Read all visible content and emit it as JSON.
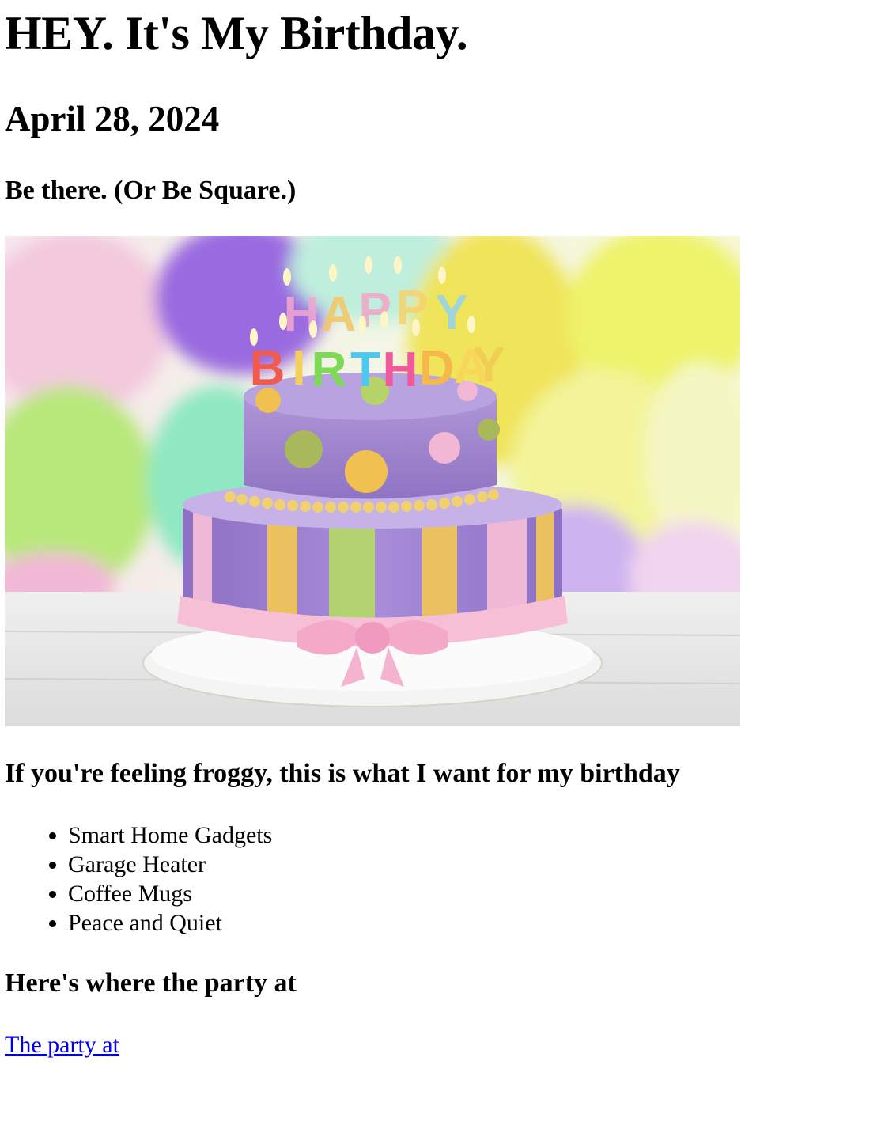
{
  "heading": "HEY. It's My Birthday.",
  "date": "April 28, 2024",
  "tagline": "Be there. (Or Be Square.)",
  "image": {
    "candle_letters_top": "HAPPY",
    "candle_letters_bottom": "BIRTHDAY"
  },
  "wishlist": {
    "title": "If you're feeling froggy, this is what I want for my birthday",
    "items": [
      "Smart Home Gadgets",
      "Garage Heater",
      "Coffee Mugs",
      "Peace and Quiet"
    ]
  },
  "location": {
    "title": "Here's where the party at",
    "link_text": "The party at"
  },
  "colors": {
    "link": "#0000ee",
    "text": "#000000"
  }
}
